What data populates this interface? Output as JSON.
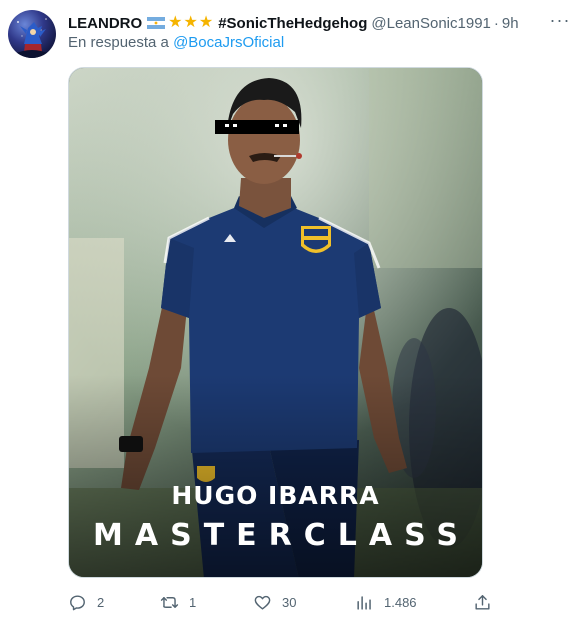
{
  "tweet": {
    "author": {
      "display_name": "LEANDRO",
      "stars": [
        "★",
        "★",
        "★"
      ],
      "name_hashtag": "#SonicTheHedgehog",
      "handle": "@LeanSonic1991",
      "separator": "·",
      "time": "9h",
      "avatar_icon": "sonic-avatar"
    },
    "more_label": "···",
    "reply_to": {
      "prefix": "En respuesta a",
      "mention": "@BocaJrsOficial"
    },
    "media": {
      "caption_line1": "HUGO IBARRA",
      "caption_line2": "MASTERCLASS"
    },
    "actions": {
      "reply_count": "2",
      "retweet_count": "1",
      "like_count": "30",
      "views_count": "1.486"
    }
  },
  "colors": {
    "text_primary": "#0f1419",
    "text_secondary": "#536471",
    "link": "#1d9bf0",
    "star": "#f5b400",
    "jersey": "#1c3a73"
  }
}
